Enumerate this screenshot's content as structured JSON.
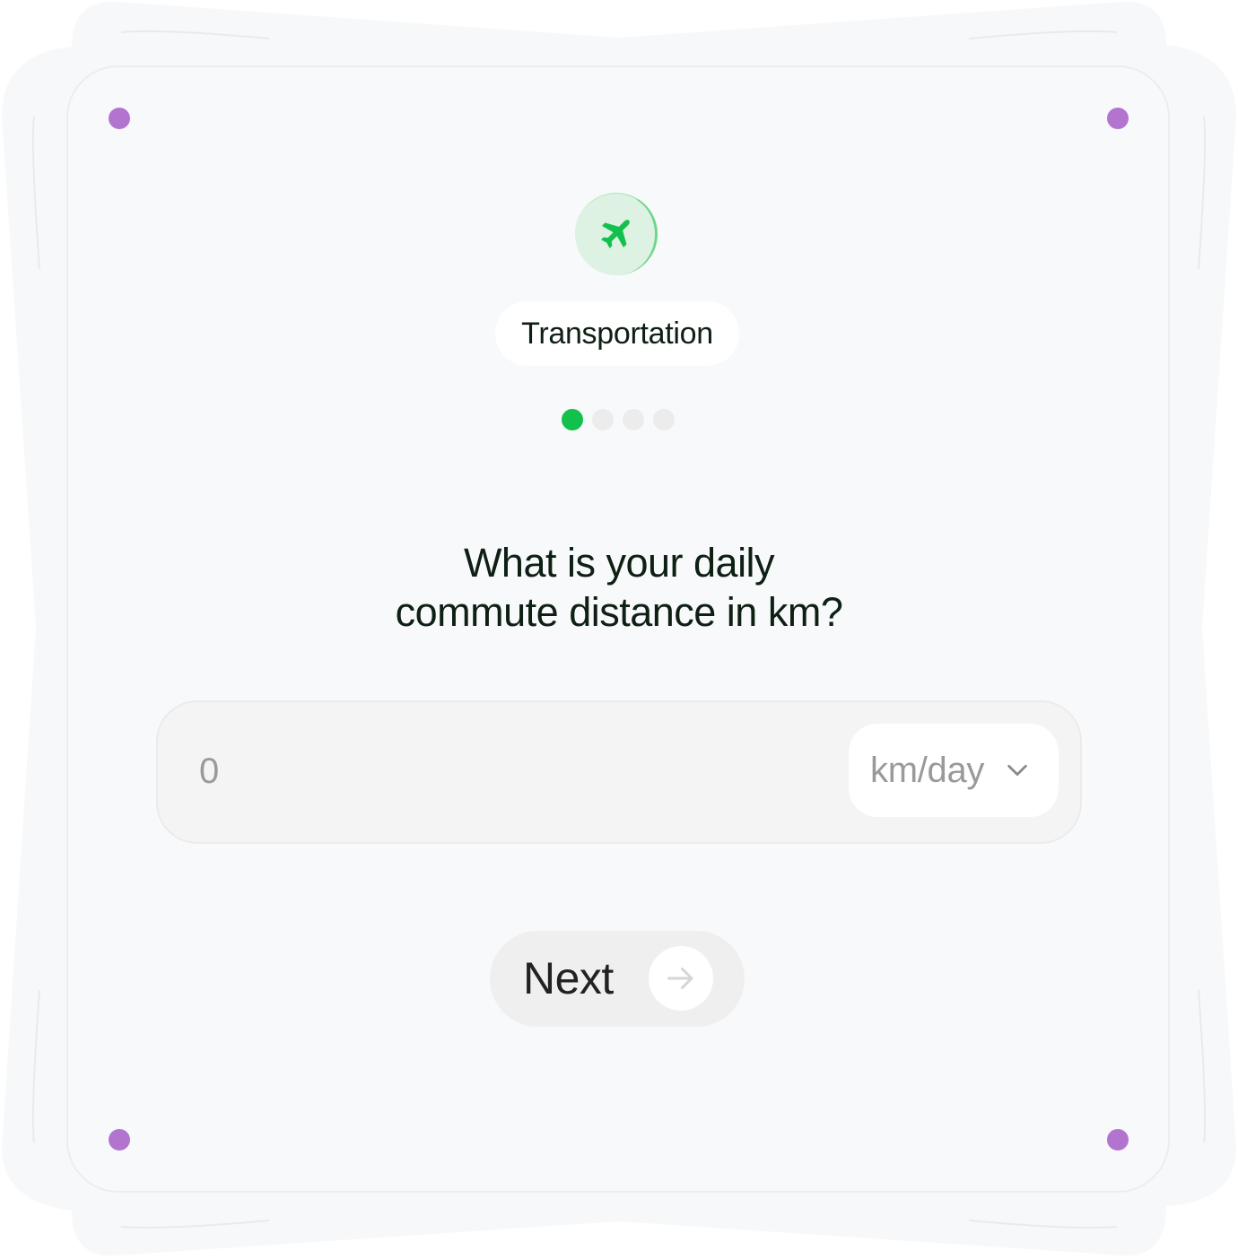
{
  "colors": {
    "accent_green": "#12c04c",
    "icon_bg": "#ddf2e2",
    "corner_dot": "#b274cf",
    "card_bg": "#f8f9fa",
    "text_dark": "#0e1f14",
    "placeholder_gray": "#9a9a9c"
  },
  "header": {
    "icon": "airplane-icon",
    "category_label": "Transportation"
  },
  "progress": {
    "current_step": 1,
    "total_steps": 4
  },
  "question": {
    "line1": "What is your daily",
    "line2": "commute distance in km?"
  },
  "distance_input": {
    "placeholder": "0",
    "value": ""
  },
  "unit_select": {
    "selected": "km/day",
    "icon": "chevron-down-icon"
  },
  "next_button": {
    "label": "Next",
    "icon": "arrow-right-icon"
  }
}
